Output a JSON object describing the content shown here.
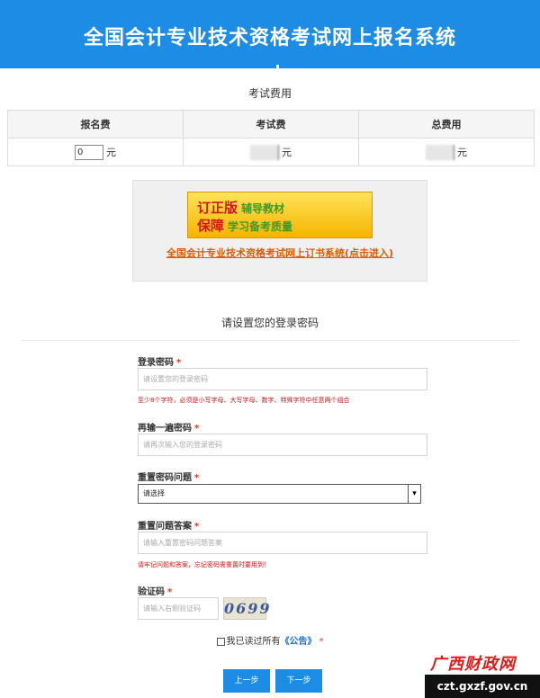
{
  "header": {
    "title": "全国会计专业技术资格考试网上报名系统"
  },
  "fees": {
    "caption": "考试费用",
    "columns": [
      "报名费",
      "考试费",
      "总费用"
    ],
    "registration_fee": "0",
    "unit": "元"
  },
  "promo": {
    "banner_line1": "订正版",
    "banner_line1_sub": "辅导教材",
    "banner_line2": "保障",
    "banner_line2_sub": "学习备考质量",
    "link": "全国会计专业技术资格考试网上订书系统(点击进入)"
  },
  "form": {
    "title": "请设置您的登录密码",
    "password": {
      "label": "登录密码",
      "placeholder": "请设置您的登录密码",
      "hint": "至少8个字符，必须是小写字母、大写字母、数字、特殊字符中任意两个组合"
    },
    "confirm": {
      "label": "再输一遍密码",
      "placeholder": "请再次输入您的登录密码"
    },
    "question": {
      "label": "重置密码问题",
      "selected": "请选择"
    },
    "answer": {
      "label": "重置问题答案",
      "placeholder": "请输入重置密码问题答案",
      "hint": "请牢记问题和答案，忘记密码需重置时要用到！"
    },
    "captcha": {
      "label": "验证码",
      "placeholder": "请输入右侧验证码",
      "code": "0699"
    },
    "required_mark": "*",
    "agree": {
      "text": "我已读过所有",
      "link": "《公告》"
    },
    "prev_label": "上一步",
    "next_label": "下一步"
  },
  "watermark": {
    "brand": "广西财政网",
    "domain": "czt.gxzf.gov.cn"
  },
  "colors": {
    "primary": "#1d8ce5",
    "error": "#c91818",
    "link": "#e05a00"
  }
}
